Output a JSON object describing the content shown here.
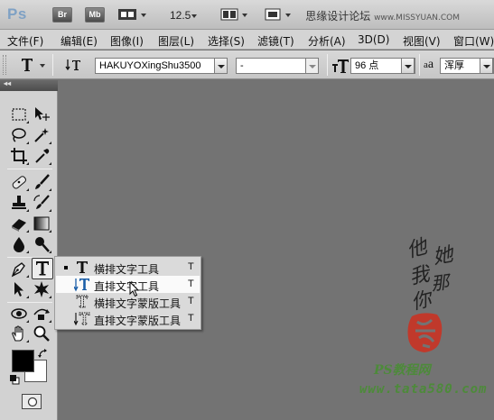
{
  "app": {
    "logo": "Ps",
    "bridge_label": "Br",
    "minibridge_label": "Mb",
    "zoom": "12.5",
    "site_text": "思缘设计论坛",
    "site_url": "www.MISSYUAN.COM"
  },
  "menu": [
    {
      "label": "文件(F)"
    },
    {
      "label": "编辑(E)"
    },
    {
      "label": "图像(I)"
    },
    {
      "label": "图层(L)"
    },
    {
      "label": "选择(S)"
    },
    {
      "label": "滤镜(T)"
    },
    {
      "label": "分析(A)"
    },
    {
      "label": "3D(D)"
    },
    {
      "label": "视图(V)"
    },
    {
      "label": "窗口(W)"
    }
  ],
  "options": {
    "font_family": "HAKUYOXingShu3500",
    "font_style": "-",
    "font_size": "96 点",
    "antialias_label": "a",
    "antialias_label2": "a",
    "antialias": "浑厚"
  },
  "toolbox": {
    "collapse_label": "◂◂"
  },
  "flyout": {
    "items": [
      {
        "label": "横排文字工具",
        "key": "T"
      },
      {
        "label": "直排文字工具",
        "key": "T"
      },
      {
        "label": "横排文字蒙版工具",
        "key": "T"
      },
      {
        "label": "直排文字蒙版工具",
        "key": "T"
      }
    ]
  },
  "watermark": {
    "brand": "PS教程网",
    "url": "www.tata580.com",
    "calligraphy": [
      "他",
      "她",
      "我",
      "那",
      "你"
    ]
  },
  "colors": {
    "foreground": "#000000",
    "background": "#ffffff",
    "seal": "#c0392b",
    "watermark_green": "#4d8a3a"
  }
}
